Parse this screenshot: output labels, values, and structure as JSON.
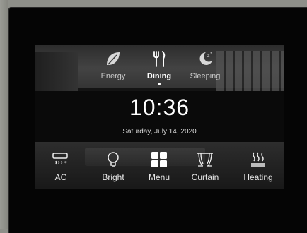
{
  "scenes": [
    {
      "label": "Energy",
      "icon": "leaf-icon"
    },
    {
      "label": "Dining",
      "icon": "fork-knife-icon",
      "active": true
    },
    {
      "label": "Sleeping",
      "icon": "moon-zz-icon"
    }
  ],
  "clock": {
    "time": "10:36",
    "date": "Saturday, July 14, 2020"
  },
  "controls": [
    {
      "label": "AC",
      "icon": "air-conditioner-icon"
    },
    {
      "label": "Bright",
      "icon": "light-bulb-icon"
    },
    {
      "label": "Menu",
      "icon": "grid-menu-icon"
    },
    {
      "label": "Curtain",
      "icon": "curtain-icon"
    },
    {
      "label": "Heating",
      "icon": "heating-icon"
    }
  ],
  "colors": {
    "bezel": "#050505",
    "wall": "#8e8f89",
    "text": "#ffffff"
  }
}
